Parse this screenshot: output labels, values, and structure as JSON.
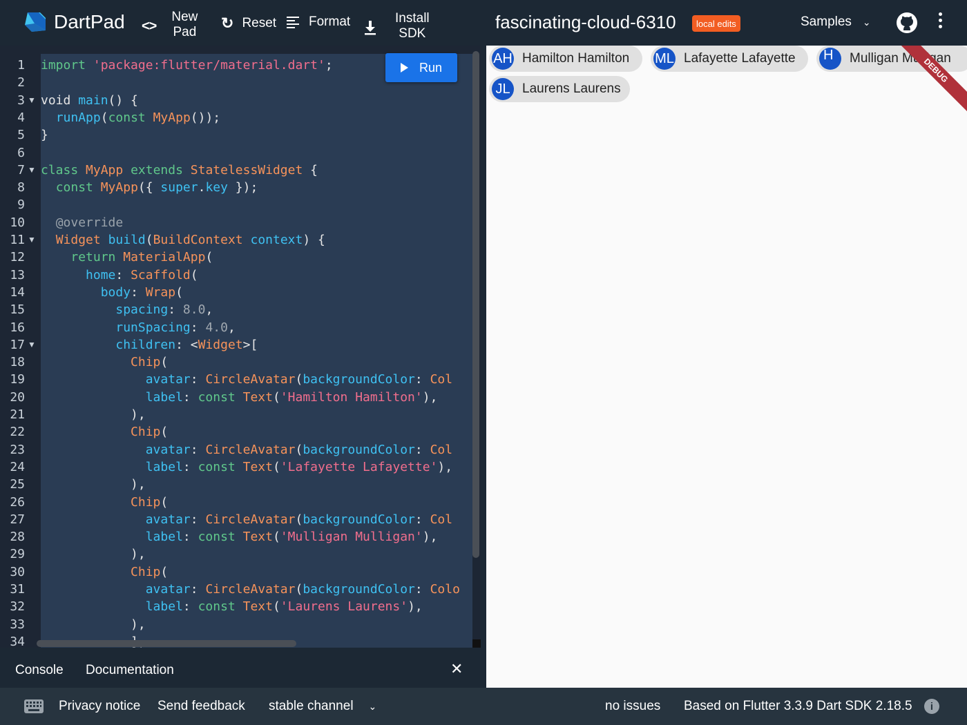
{
  "header": {
    "app_name": "DartPad",
    "new_pad": [
      "New",
      "Pad"
    ],
    "reset": "Reset",
    "format": "Format",
    "install_sdk": [
      "Install",
      "SDK"
    ],
    "pad_title": "fascinating-cloud-6310",
    "badge": "local edits",
    "samples": "Samples"
  },
  "editor": {
    "run_label": "Run",
    "line_numbers": [
      "1",
      "2",
      "3",
      "4",
      "5",
      "6",
      "7",
      "8",
      "9",
      "10",
      "11",
      "12",
      "13",
      "14",
      "15",
      "16",
      "17",
      "18",
      "19",
      "20",
      "21",
      "22",
      "23",
      "24",
      "25",
      "26",
      "27",
      "28",
      "29",
      "30",
      "31",
      "32",
      "33",
      "34"
    ],
    "fold_markers": [
      3,
      7,
      11,
      17
    ],
    "lines": [
      [
        [
          "kw",
          "import"
        ],
        [
          "pl",
          " "
        ],
        [
          "str",
          "'package:flutter/material.dart'"
        ],
        [
          "pl",
          ";"
        ]
      ],
      [],
      [
        [
          "pl",
          "void "
        ],
        [
          "fn",
          "main"
        ],
        [
          "pl",
          "() {"
        ]
      ],
      [
        [
          "pl",
          "  "
        ],
        [
          "fn",
          "runApp"
        ],
        [
          "pl",
          "("
        ],
        [
          "kw",
          "const"
        ],
        [
          "pl",
          " "
        ],
        [
          "cls",
          "MyApp"
        ],
        [
          "pl",
          "());"
        ]
      ],
      [
        [
          "pl",
          "}"
        ]
      ],
      [],
      [
        [
          "kw",
          "class"
        ],
        [
          "pl",
          " "
        ],
        [
          "cls",
          "MyApp"
        ],
        [
          "pl",
          " "
        ],
        [
          "kw",
          "extends"
        ],
        [
          "pl",
          " "
        ],
        [
          "cls",
          "StatelessWidget"
        ],
        [
          "pl",
          " {"
        ]
      ],
      [
        [
          "pl",
          "  "
        ],
        [
          "kw",
          "const"
        ],
        [
          "pl",
          " "
        ],
        [
          "cls",
          "MyApp"
        ],
        [
          "pl",
          "({ "
        ],
        [
          "fn",
          "super"
        ],
        [
          "pl",
          "."
        ],
        [
          "fn",
          "key"
        ],
        [
          "pl",
          " });"
        ]
      ],
      [],
      [
        [
          "pl",
          "  "
        ],
        [
          "ann",
          "@override"
        ]
      ],
      [
        [
          "pl",
          "  "
        ],
        [
          "cls",
          "Widget"
        ],
        [
          "pl",
          " "
        ],
        [
          "fn",
          "build"
        ],
        [
          "pl",
          "("
        ],
        [
          "cls",
          "BuildContext"
        ],
        [
          "pl",
          " "
        ],
        [
          "fn",
          "context"
        ],
        [
          "pl",
          ") {"
        ]
      ],
      [
        [
          "pl",
          "    "
        ],
        [
          "kw",
          "return"
        ],
        [
          "pl",
          " "
        ],
        [
          "cls",
          "MaterialApp"
        ],
        [
          "pl",
          "("
        ]
      ],
      [
        [
          "pl",
          "      "
        ],
        [
          "fn",
          "home"
        ],
        [
          "pl",
          ": "
        ],
        [
          "cls",
          "Scaffold"
        ],
        [
          "pl",
          "("
        ]
      ],
      [
        [
          "pl",
          "        "
        ],
        [
          "fn",
          "body"
        ],
        [
          "pl",
          ": "
        ],
        [
          "cls",
          "Wrap"
        ],
        [
          "pl",
          "("
        ]
      ],
      [
        [
          "pl",
          "          "
        ],
        [
          "fn",
          "spacing"
        ],
        [
          "pl",
          ": "
        ],
        [
          "num",
          "8.0"
        ],
        [
          "pl",
          ","
        ]
      ],
      [
        [
          "pl",
          "          "
        ],
        [
          "fn",
          "runSpacing"
        ],
        [
          "pl",
          ": "
        ],
        [
          "num",
          "4.0"
        ],
        [
          "pl",
          ","
        ]
      ],
      [
        [
          "pl",
          "          "
        ],
        [
          "fn",
          "children"
        ],
        [
          "pl",
          ": <"
        ],
        [
          "cls",
          "Widget"
        ],
        [
          "pl",
          ">["
        ]
      ],
      [
        [
          "pl",
          "            "
        ],
        [
          "cls",
          "Chip"
        ],
        [
          "pl",
          "("
        ]
      ],
      [
        [
          "pl",
          "              "
        ],
        [
          "fn",
          "avatar"
        ],
        [
          "pl",
          ": "
        ],
        [
          "cls",
          "CircleAvatar"
        ],
        [
          "pl",
          "("
        ],
        [
          "fn",
          "backgroundColor"
        ],
        [
          "pl",
          ": "
        ],
        [
          "cls",
          "Col"
        ]
      ],
      [
        [
          "pl",
          "              "
        ],
        [
          "fn",
          "label"
        ],
        [
          "pl",
          ": "
        ],
        [
          "kw",
          "const"
        ],
        [
          "pl",
          " "
        ],
        [
          "cls",
          "Text"
        ],
        [
          "pl",
          "("
        ],
        [
          "str",
          "'Hamilton Hamilton'"
        ],
        [
          "pl",
          "),"
        ]
      ],
      [
        [
          "pl",
          "            ),"
        ]
      ],
      [
        [
          "pl",
          "            "
        ],
        [
          "cls",
          "Chip"
        ],
        [
          "pl",
          "("
        ]
      ],
      [
        [
          "pl",
          "              "
        ],
        [
          "fn",
          "avatar"
        ],
        [
          "pl",
          ": "
        ],
        [
          "cls",
          "CircleAvatar"
        ],
        [
          "pl",
          "("
        ],
        [
          "fn",
          "backgroundColor"
        ],
        [
          "pl",
          ": "
        ],
        [
          "cls",
          "Col"
        ]
      ],
      [
        [
          "pl",
          "              "
        ],
        [
          "fn",
          "label"
        ],
        [
          "pl",
          ": "
        ],
        [
          "kw",
          "const"
        ],
        [
          "pl",
          " "
        ],
        [
          "cls",
          "Text"
        ],
        [
          "pl",
          "("
        ],
        [
          "str",
          "'Lafayette Lafayette'"
        ],
        [
          "pl",
          "),"
        ]
      ],
      [
        [
          "pl",
          "            ),"
        ]
      ],
      [
        [
          "pl",
          "            "
        ],
        [
          "cls",
          "Chip"
        ],
        [
          "pl",
          "("
        ]
      ],
      [
        [
          "pl",
          "              "
        ],
        [
          "fn",
          "avatar"
        ],
        [
          "pl",
          ": "
        ],
        [
          "cls",
          "CircleAvatar"
        ],
        [
          "pl",
          "("
        ],
        [
          "fn",
          "backgroundColor"
        ],
        [
          "pl",
          ": "
        ],
        [
          "cls",
          "Col"
        ]
      ],
      [
        [
          "pl",
          "              "
        ],
        [
          "fn",
          "label"
        ],
        [
          "pl",
          ": "
        ],
        [
          "kw",
          "const"
        ],
        [
          "pl",
          " "
        ],
        [
          "cls",
          "Text"
        ],
        [
          "pl",
          "("
        ],
        [
          "str",
          "'Mulligan Mulligan'"
        ],
        [
          "pl",
          "),"
        ]
      ],
      [
        [
          "pl",
          "            ),"
        ]
      ],
      [
        [
          "pl",
          "            "
        ],
        [
          "cls",
          "Chip"
        ],
        [
          "pl",
          "("
        ]
      ],
      [
        [
          "pl",
          "              "
        ],
        [
          "fn",
          "avatar"
        ],
        [
          "pl",
          ": "
        ],
        [
          "cls",
          "CircleAvatar"
        ],
        [
          "pl",
          "("
        ],
        [
          "fn",
          "backgroundColor"
        ],
        [
          "pl",
          ": "
        ],
        [
          "cls",
          "Colo"
        ]
      ],
      [
        [
          "pl",
          "              "
        ],
        [
          "fn",
          "label"
        ],
        [
          "pl",
          ": "
        ],
        [
          "kw",
          "const"
        ],
        [
          "pl",
          " "
        ],
        [
          "cls",
          "Text"
        ],
        [
          "pl",
          "("
        ],
        [
          "str",
          "'Laurens Laurens'"
        ],
        [
          "pl",
          "),"
        ]
      ],
      [
        [
          "pl",
          "            ),"
        ]
      ],
      [
        [
          "pl",
          "            ],"
        ]
      ]
    ]
  },
  "console": {
    "tab_console": "Console",
    "tab_documentation": "Documentation"
  },
  "preview": {
    "chips": [
      {
        "initials": "AH",
        "label": "Hamilton Hamilton"
      },
      {
        "initials": "ML",
        "label": "Lafayette Lafayette"
      },
      {
        "initials": "H",
        "label": "Mulligan Mulligan"
      },
      {
        "initials": "JL",
        "label": "Laurens Laurens"
      }
    ],
    "debug_banner": "DEBUG"
  },
  "footer": {
    "privacy": "Privacy notice",
    "feedback": "Send feedback",
    "channel": "stable channel",
    "issues": "no issues",
    "version": "Based on Flutter 3.3.9 Dart SDK 2.18.5"
  },
  "colors": {
    "accent": "#1a73e8",
    "badge": "#f25d22",
    "chip_avatar": "#1654c7"
  }
}
